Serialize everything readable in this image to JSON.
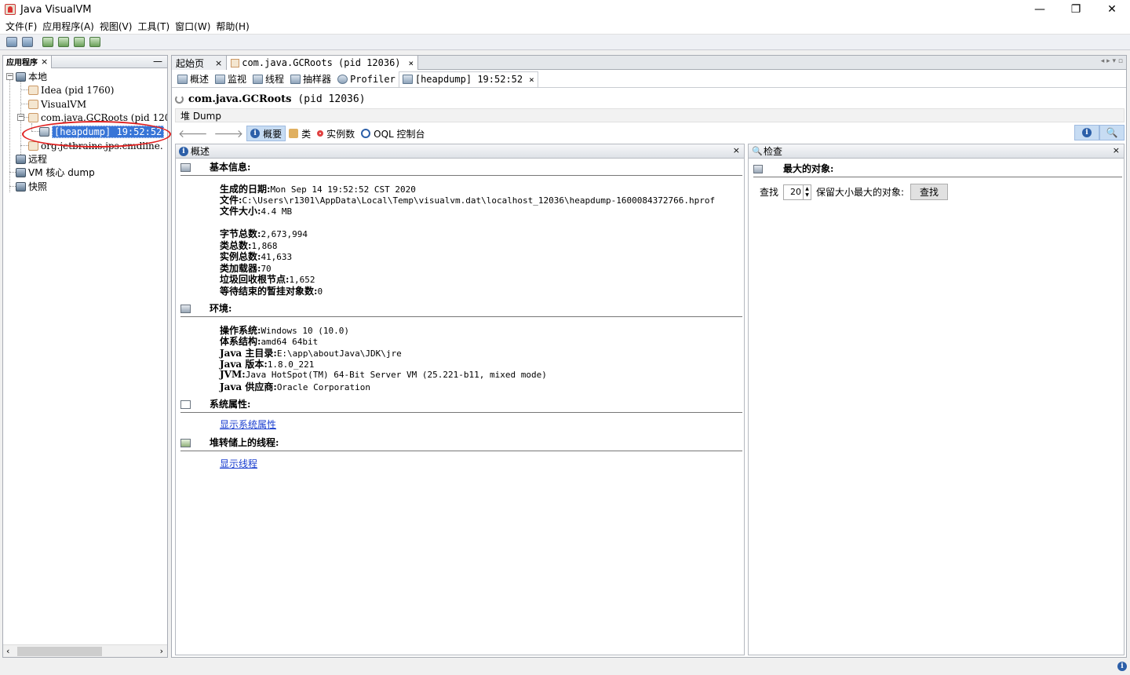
{
  "window": {
    "title": "Java VisualVM",
    "minimize": "—",
    "restore": "❐",
    "close": "✕"
  },
  "menu": [
    "文件(F)",
    "应用程序(A)",
    "视图(V)",
    "工具(T)",
    "窗口(W)",
    "帮助(H)"
  ],
  "left_panel": {
    "tab_label": "应用程序",
    "tab_close": "×",
    "minimize": "—",
    "tree": {
      "local": "本地",
      "idea": "Idea (pid 1760)",
      "visualvm": "VisualVM",
      "gcroots": "com.java.GCRoots (pid 120",
      "heapdump": "[heapdump] 19:52:52",
      "jetbrains": "org.jetbrains.jps.cmdline.",
      "remote": "远程",
      "vmcore": "VM 核心 dump",
      "snapshot": "快照"
    }
  },
  "doc_tabs": {
    "start": "起始页",
    "gcroots": "com.java.GCRoots (pid 12036)",
    "close": "×",
    "nav": "◂ ▸ ▾ ▫"
  },
  "sub_tabs": {
    "overview": "概述",
    "monitor": "监视",
    "threads": "线程",
    "sampler": "抽样器",
    "profiler": "Profiler",
    "heapdump": "[heapdump] 19:52:52",
    "close": "×"
  },
  "process": {
    "name": "com.java.GCRoots",
    "pid": "(pid 12036)"
  },
  "heap_bar": "堆 Dump",
  "nav": {
    "summary": "概要",
    "classes": "类",
    "instances": "实例数",
    "oql": "OQL 控制台"
  },
  "overview_pane": {
    "title": "概述",
    "close": "×",
    "basic": {
      "title": "基本信息:",
      "items": [
        {
          "k": "生成的日期:",
          "v": "Mon Sep 14 19:52:52 CST 2020"
        },
        {
          "k": "文件:",
          "v": "C:\\Users\\r1301\\AppData\\Local\\Temp\\visualvm.dat\\localhost_12036\\heapdump-1600084372766.hprof"
        },
        {
          "k": "文件大小:",
          "v": "4.4 MB"
        },
        {
          "k": "字节总数:",
          "v": "2,673,994"
        },
        {
          "k": "类总数:",
          "v": "1,868"
        },
        {
          "k": "实例总数:",
          "v": "41,633"
        },
        {
          "k": "类加载器:",
          "v": "70"
        },
        {
          "k": "垃圾回收根节点:",
          "v": "1,652"
        },
        {
          "k": "等待结束的暂挂对象数:",
          "v": "0"
        }
      ]
    },
    "env": {
      "title": "环境:",
      "items": [
        {
          "k": "操作系统:",
          "v": "Windows 10 (10.0)"
        },
        {
          "k": "体系结构:",
          "v": "amd64 64bit"
        },
        {
          "k": "Java 主目录:",
          "v": "E:\\app\\aboutJava\\JDK\\jre"
        },
        {
          "k": "Java 版本:",
          "v": "1.8.0_221"
        },
        {
          "k": "JVM:",
          "v": "Java HotSpot(TM) 64-Bit Server VM (25.221-b11, mixed mode)"
        },
        {
          "k": "Java 供应商:",
          "v": "Oracle Corporation"
        }
      ]
    },
    "sysprops": {
      "title": "系统属性:",
      "link": "显示系统属性"
    },
    "threads": {
      "title": "堆转储上的线程:",
      "link": "显示线程"
    }
  },
  "inspect_pane": {
    "title": "检查",
    "close": "×",
    "section": "最大的对象:",
    "find_label": "查找",
    "count": "20",
    "suffix": "保留大小最大的对象:",
    "button": "查找"
  }
}
